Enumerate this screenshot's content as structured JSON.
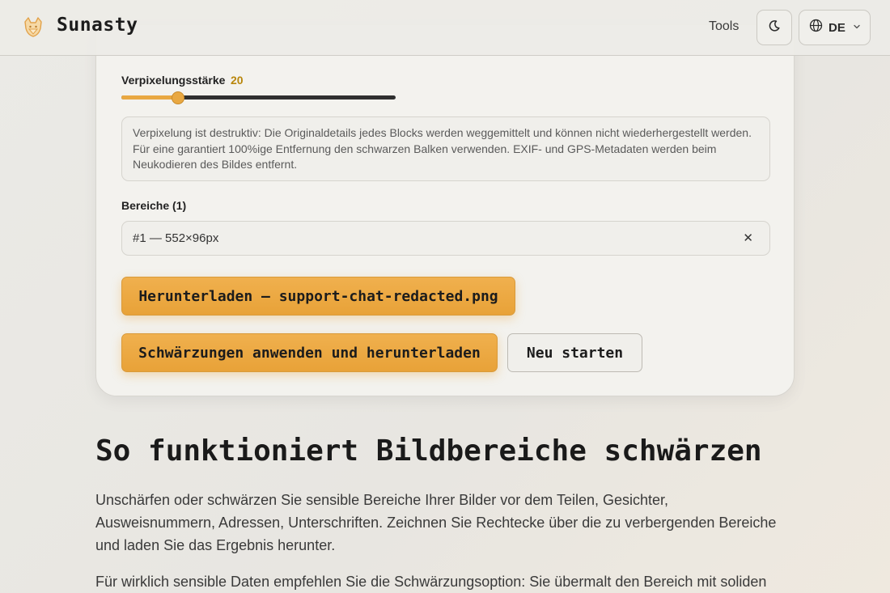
{
  "header": {
    "brand": "Sunasty",
    "nav_tools": "Tools",
    "language": "DE"
  },
  "panel": {
    "strength_label": "Verpixelungsstärke",
    "strength_value": "20",
    "slider_value": 20,
    "notice": "Verpixelung ist destruktiv: Die Originaldetails jedes Blocks werden weggemittelt und können nicht wiederhergestellt werden. Für eine garantiert 100%ige Entfernung den schwarzen Balken verwenden. EXIF- und GPS-Metadaten werden beim Neukodieren des Bildes entfernt.",
    "areas_label": "Bereiche (1)",
    "areas": [
      {
        "label": "#1 — 552×96px"
      }
    ],
    "download_button": "Herunterladen — support-chat-redacted.png",
    "apply_button": "Schwärzungen anwenden und herunterladen",
    "restart_button": "Neu starten"
  },
  "article": {
    "title": "So funktioniert Bildbereiche schwärzen",
    "p1": "Unschärfen oder schwärzen Sie sensible Bereiche Ihrer Bilder vor dem Teilen, Gesichter, Ausweisnummern, Adressen, Unterschriften. Zeichnen Sie Rechtecke über die zu verbergenden Bereiche und laden Sie das Ergebnis herunter.",
    "p2": "Für wirklich sensible Daten empfehlen Sie die Schwärzungsoption: Sie übermalt den Bereich mit soliden"
  },
  "colors": {
    "accent": "#e9a842",
    "accent_text": "#b8860b",
    "background": "#ebeae6"
  },
  "icons": {
    "logo": "fox-logo-icon",
    "theme": "moon-icon",
    "language": "globe-icon",
    "dropdown": "chevron-down-icon",
    "remove": "close-icon"
  }
}
